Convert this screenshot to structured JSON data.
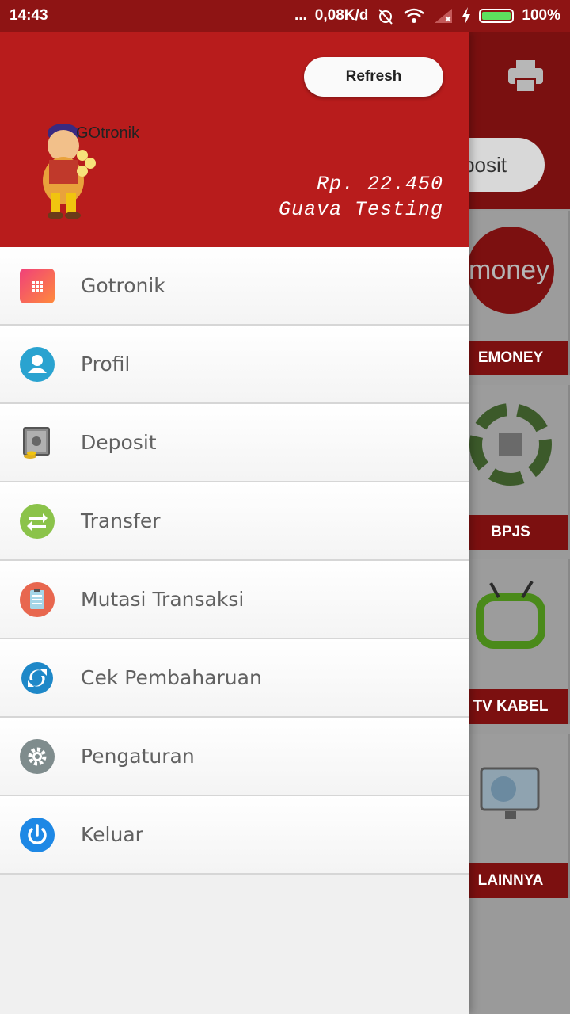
{
  "status_bar": {
    "time": "14:43",
    "network_speed": "0,08K/d",
    "battery_percent": "100%",
    "dots": "..."
  },
  "drawer": {
    "refresh_label": "Refresh",
    "balance": "Rp. 22.450",
    "user_name": "Guava Testing",
    "logo_text": "GOtronik",
    "menu": [
      {
        "label": "Gotronik",
        "icon": "grid-icon",
        "color": "#f0407a"
      },
      {
        "label": "Profil",
        "icon": "user-icon",
        "color": "#2aa3d0"
      },
      {
        "label": "Deposit",
        "icon": "safe-icon",
        "color": "#7a7a7a"
      },
      {
        "label": "Transfer",
        "icon": "transfer-icon",
        "color": "#8bc34a"
      },
      {
        "label": "Mutasi Transaksi",
        "icon": "clipboard-icon",
        "color": "#e8674f"
      },
      {
        "label": "Cek Pembaharuan",
        "icon": "refresh-icon",
        "color": "#1e88c8"
      },
      {
        "label": "Pengaturan",
        "icon": "gear-icon",
        "color": "#7f8c8d"
      },
      {
        "label": "Keluar",
        "icon": "power-icon",
        "color": "#1e88e5"
      }
    ]
  },
  "background": {
    "deposit_label": "posit",
    "cards": [
      "EMONEY",
      "BPJS",
      "TV KABEL",
      "LAINNYA"
    ],
    "emoney_text": "money"
  },
  "colors": {
    "header_red": "#b81c1c",
    "status_red": "#8e1414"
  }
}
